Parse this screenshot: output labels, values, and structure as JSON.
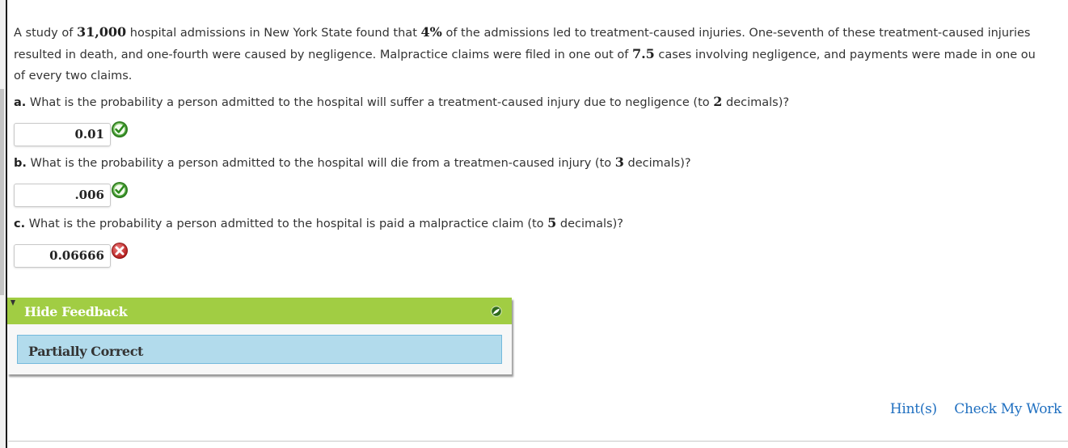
{
  "problem": {
    "line1": {
      "pre": "A study of ",
      "n1": "31,000",
      "mid": " hospital admissions in New York State found that ",
      "n2": "4%",
      "post": " of the admissions led to treatment-caused injuries. One-seventh of these treatment-caused injuries"
    },
    "line2": {
      "pre": "resulted in death, and one-fourth were caused by negligence. Malpractice claims were filed in one out of ",
      "n1": "7.5",
      "post": " cases involving negligence, and payments were made in one ou"
    },
    "line3": "of every two claims."
  },
  "questions": [
    {
      "letter": "a.",
      "pre": " What is the probability a person admitted to the hospital will suffer a treatment-caused injury due to negligence (to ",
      "decimals": "2",
      "post": " decimals)?",
      "answer_value": "0.01",
      "status": "correct"
    },
    {
      "letter": "b.",
      "pre": " What is the probability a person admitted to the hospital will die from a treatmen-caused injury (to ",
      "decimals": "3",
      "post": " decimals)?",
      "answer_value": ".006",
      "status": "correct"
    },
    {
      "letter": "c.",
      "pre": " What is the probability a person admitted to the hospital is paid a malpractice claim (to ",
      "decimals": "5",
      "post": " decimals)?",
      "answer_value": "0.06666",
      "status": "incorrect"
    }
  ],
  "feedback": {
    "toggle_label": "Hide Feedback",
    "status_text": "Partially Correct",
    "header_color": "#a1cd43",
    "status_bg": "#b2dbec"
  },
  "actions": {
    "hints_label": "Hint(s)",
    "check_label": "Check My Work",
    "link_color": "#1f6fc0"
  },
  "icons": {
    "correct": "check-circle-icon",
    "incorrect": "x-circle-icon",
    "feedback_toggle": "triangle-down-icon",
    "feedback_badge": "leaf-icon"
  }
}
